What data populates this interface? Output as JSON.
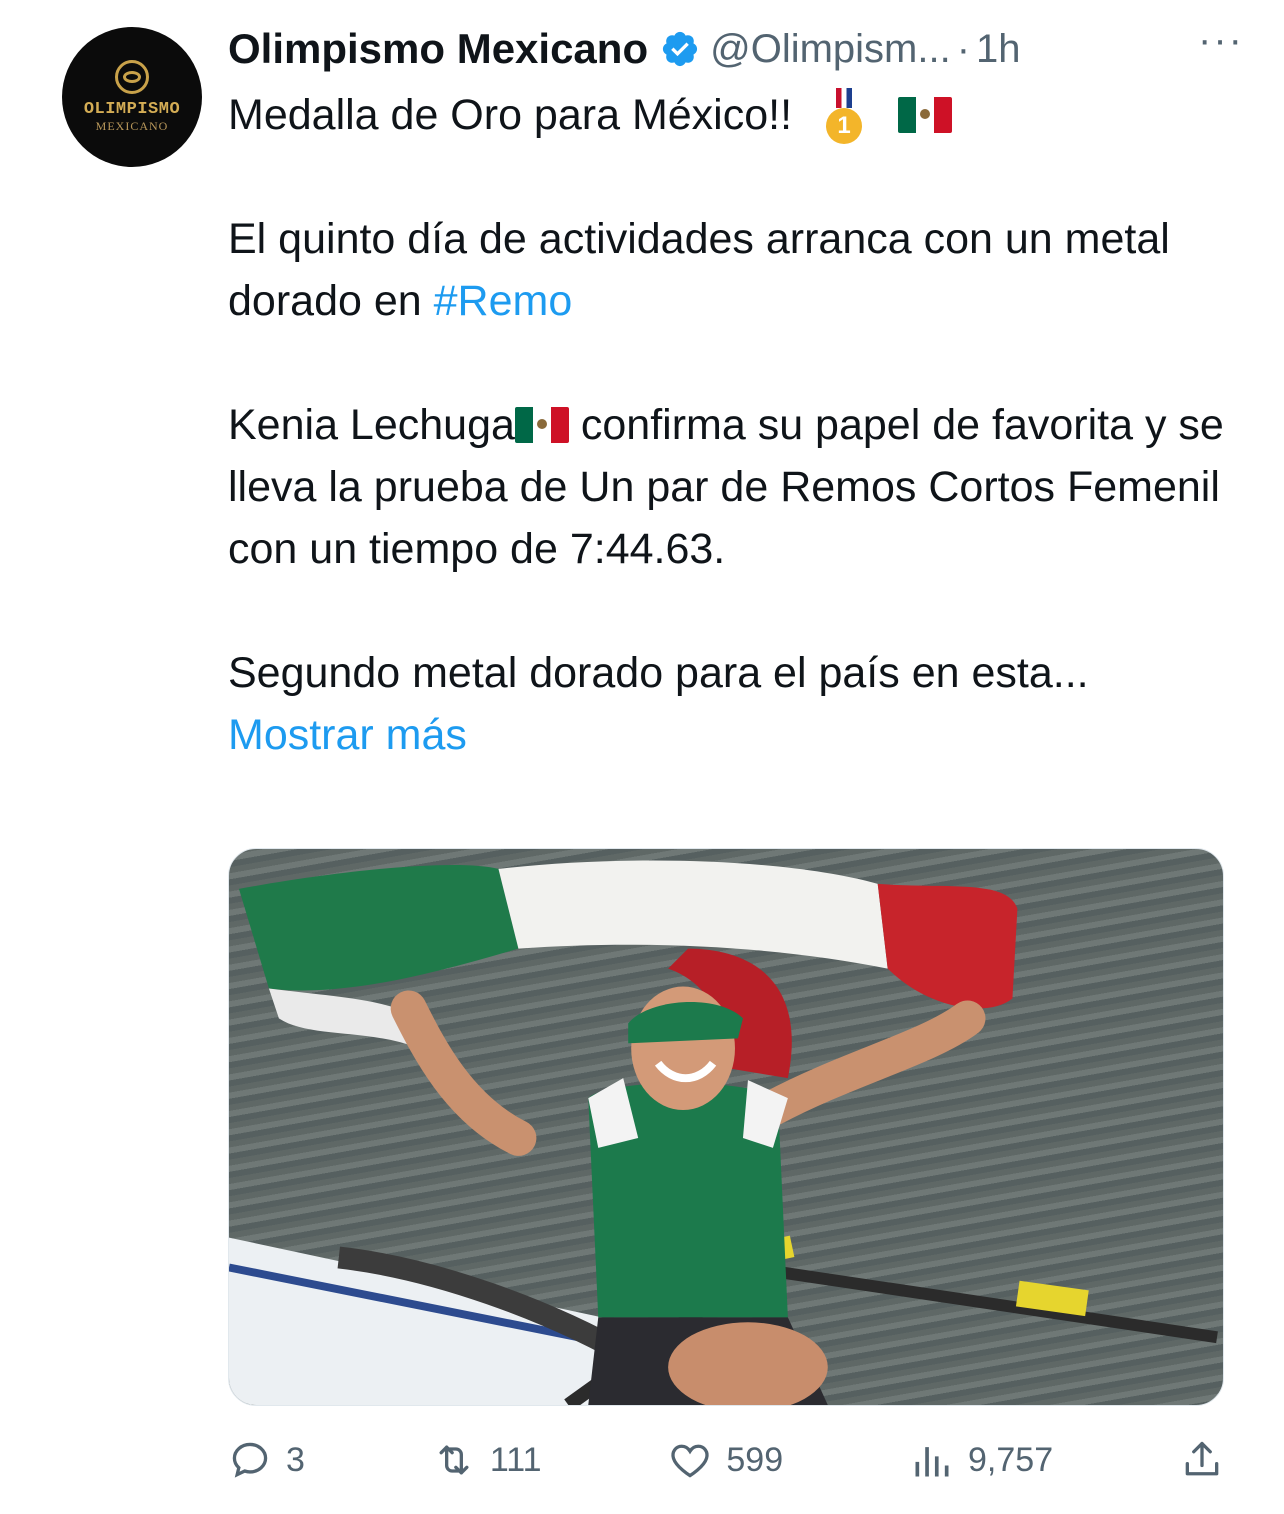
{
  "tweet": {
    "author": {
      "name": "Olimpismo Mexicano",
      "handle": "@Olimpism...",
      "verified_icon": "verified-badge-icon",
      "avatar_text_line1": "OLIMPISMO",
      "avatar_text_line2": "MEXICANO"
    },
    "separator": "·",
    "time": "1h",
    "more_label": "···",
    "text": {
      "line1": "Medalla de Oro para México!!",
      "medal_number": "1",
      "para2_a": "El quinto día de actividades arranca con un metal dorado en ",
      "hashtag": "#Remo",
      "para3_a": "Kenia Lechuga",
      "para3_b": " confirma su papel de favorita y se lleva la prueba de Un par de Remos Cortos Femenil con un tiempo de 7:44.63.",
      "para4": "Segundo metal dorado para el país en esta...",
      "show_more": "Mostrar más"
    },
    "actions": {
      "replies": "3",
      "retweets": "111",
      "likes": "599",
      "views": "9,757"
    },
    "colors": {
      "link": "#1d9bf0",
      "secondary_text": "#536471",
      "verified": "#1d9bf0"
    }
  }
}
